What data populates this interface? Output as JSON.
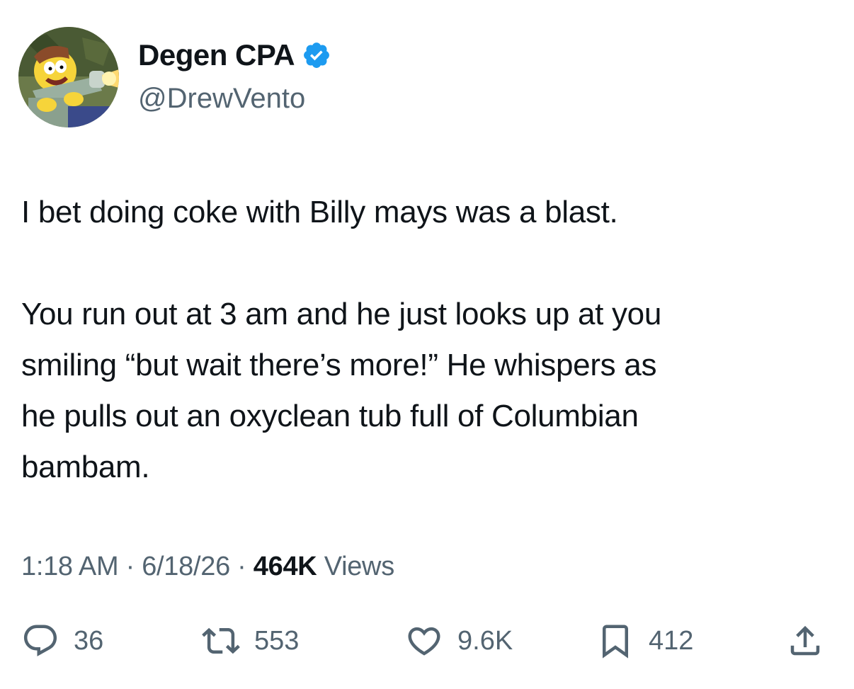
{
  "user": {
    "display_name": "Degen CPA",
    "handle": "@DrewVento",
    "verified": true,
    "avatar_icon": "cartoon-character-avatar"
  },
  "tweet": {
    "text": "I bet doing coke with Billy mays was a blast.\n\nYou run out at 3 am and he just looks up at you\nsmiling “but wait there’s more!” He whispers as\nhe pulls out an oxyclean tub full of Columbian\nbambam.",
    "time": "1:18 AM",
    "separator": "·",
    "date": "6/18/26",
    "views_count": "464K",
    "views_label": "Views"
  },
  "actions": {
    "replies": "36",
    "retweets": "553",
    "likes": "9.6K",
    "bookmarks": "412"
  },
  "colors": {
    "text": "#0f1419",
    "secondary": "#536471",
    "verified_blue": "#1d9bf0"
  }
}
